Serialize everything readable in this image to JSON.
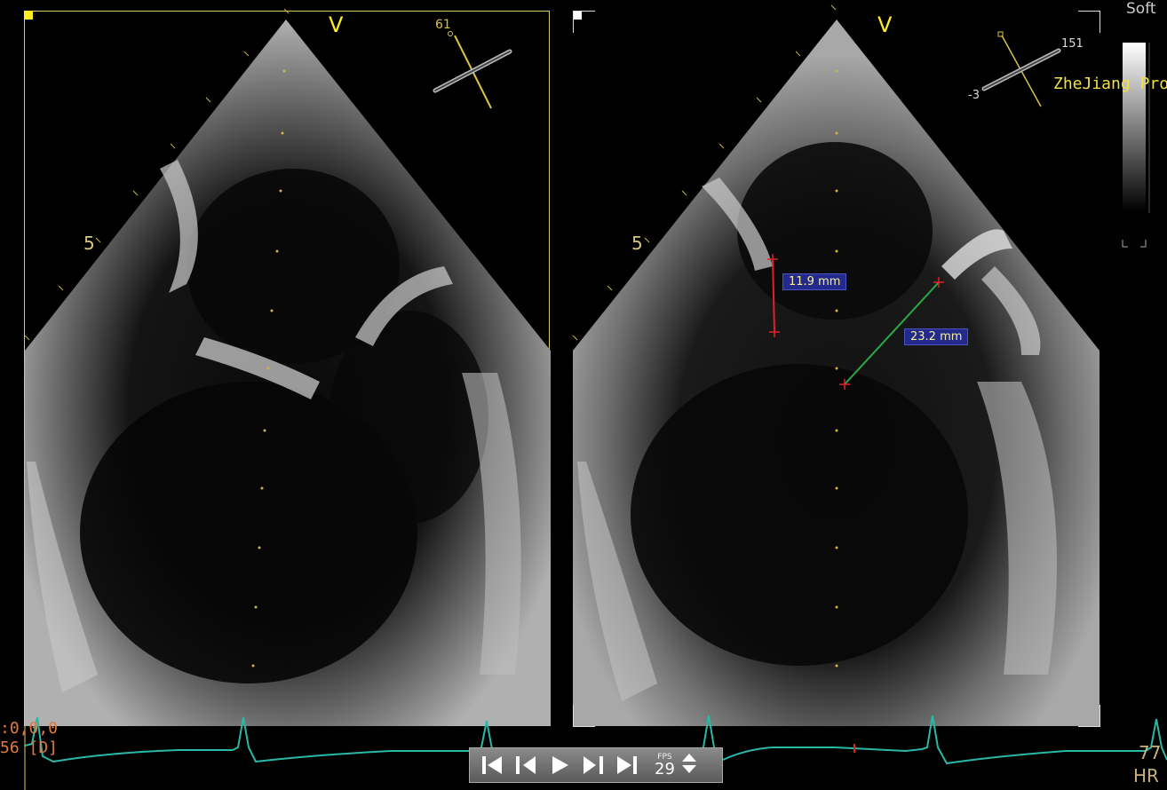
{
  "left_view": {
    "depth_label": "5",
    "v_marker": "V",
    "angle": "61"
  },
  "right_view": {
    "depth_label": "5",
    "v_marker": "V",
    "angle_top": "151",
    "angle_side": "-3",
    "measurements": [
      {
        "label": "11.9 mm",
        "color": "#e0202a"
      },
      {
        "label": "23.2 mm",
        "color": "#2aaa44"
      }
    ]
  },
  "overlay": {
    "hospital": "ZheJiang Pro",
    "soft_label": "Soft"
  },
  "frame_info": {
    "line1": ":0,0,0",
    "line2": "56 [D]"
  },
  "hr_info": {
    "value": "77",
    "label": "HR"
  },
  "player": {
    "fps_label": "FPS",
    "fps_value": "29",
    "icons": [
      "skip-to-start-icon",
      "step-back-icon",
      "play-icon",
      "step-forward-icon",
      "skip-to-end-icon"
    ]
  },
  "colors": {
    "ecg": "#2ab8a8",
    "accent_yellow": "#ffee22",
    "label_bg": "#232a8c"
  }
}
